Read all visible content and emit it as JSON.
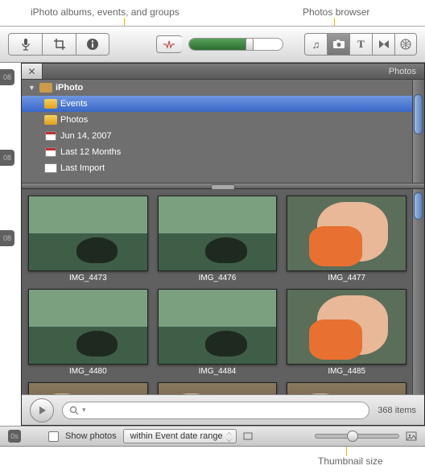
{
  "callouts": {
    "sourceTree": "iPhoto albums, events, and groups",
    "browserTab": "Photos browser",
    "thumbSlider": "Thumbnail size"
  },
  "panel": {
    "title": "Photos"
  },
  "rulerMarkers": [
    "08",
    "08",
    "08"
  ],
  "rulerBottom": "0s",
  "tree": {
    "root": "iPhoto",
    "items": [
      {
        "label": "Events",
        "icon": "album",
        "selected": true
      },
      {
        "label": "Photos",
        "icon": "album",
        "selected": false
      },
      {
        "label": "Jun 14, 2007",
        "icon": "calendar",
        "selected": false
      },
      {
        "label": "Last 12 Months",
        "icon": "calendar",
        "selected": false
      },
      {
        "label": "Last Import",
        "icon": "import",
        "selected": false
      }
    ]
  },
  "thumbs": [
    {
      "label": "IMG_4473",
      "style": "water"
    },
    {
      "label": "IMG_4476",
      "style": "water"
    },
    {
      "label": "IMG_4477",
      "style": "baby"
    },
    {
      "label": "IMG_4480",
      "style": "water"
    },
    {
      "label": "IMG_4484",
      "style": "water"
    },
    {
      "label": "IMG_4485",
      "style": "baby"
    },
    {
      "label": "",
      "style": "carousel"
    },
    {
      "label": "",
      "style": "carousel"
    },
    {
      "label": "",
      "style": "carousel"
    }
  ],
  "search": {
    "placeholder": "",
    "prefix": "Q"
  },
  "itemCount": "368 items",
  "bottom": {
    "checkboxLabel": "Show photos",
    "popup": "within Event date range"
  }
}
